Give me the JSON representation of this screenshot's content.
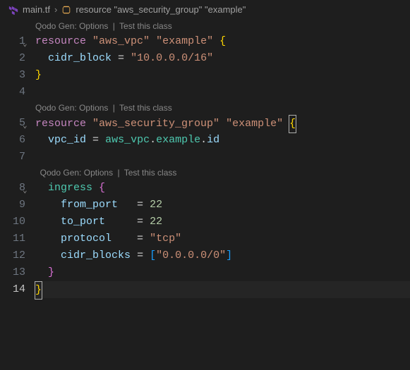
{
  "breadcrumb": {
    "file": "main.tf",
    "symbol": "resource \"aws_security_group\" \"example\""
  },
  "codelens": {
    "prefix": "Qodo Gen:",
    "options": "Options",
    "sep": "|",
    "test": "Test this class"
  },
  "lines": {
    "l1": {
      "num": "1",
      "kw": "resource",
      "type": "\"aws_vpc\"",
      "name": "\"example\"",
      "brace": "{"
    },
    "l2": {
      "num": "2",
      "prop": "cidr_block",
      "eq": "=",
      "val": "\"10.0.0.0/16\""
    },
    "l3": {
      "num": "3",
      "brace": "}"
    },
    "l4": {
      "num": "4"
    },
    "l5": {
      "num": "5",
      "kw": "resource",
      "type": "\"aws_security_group\"",
      "name": "\"example\"",
      "brace": "{"
    },
    "l6": {
      "num": "6",
      "prop": "vpc_id",
      "eq": "=",
      "val1": "aws_vpc",
      "dot1": ".",
      "val2": "example",
      "dot2": ".",
      "val3": "id"
    },
    "l7": {
      "num": "7"
    },
    "l8": {
      "num": "8",
      "kw": "ingress",
      "brace": "{"
    },
    "l9": {
      "num": "9",
      "prop": "from_port",
      "eq": "=",
      "val": "22"
    },
    "l10": {
      "num": "10",
      "prop": "to_port",
      "eq": "=",
      "val": "22"
    },
    "l11": {
      "num": "11",
      "prop": "protocol",
      "eq": "=",
      "val": "\"tcp\""
    },
    "l12": {
      "num": "12",
      "prop": "cidr_blocks",
      "eq": "=",
      "lb": "[",
      "val": "\"0.0.0.0/0\"",
      "rb": "]"
    },
    "l13": {
      "num": "13",
      "brace": "}"
    },
    "l14": {
      "num": "14",
      "brace": "}"
    }
  }
}
